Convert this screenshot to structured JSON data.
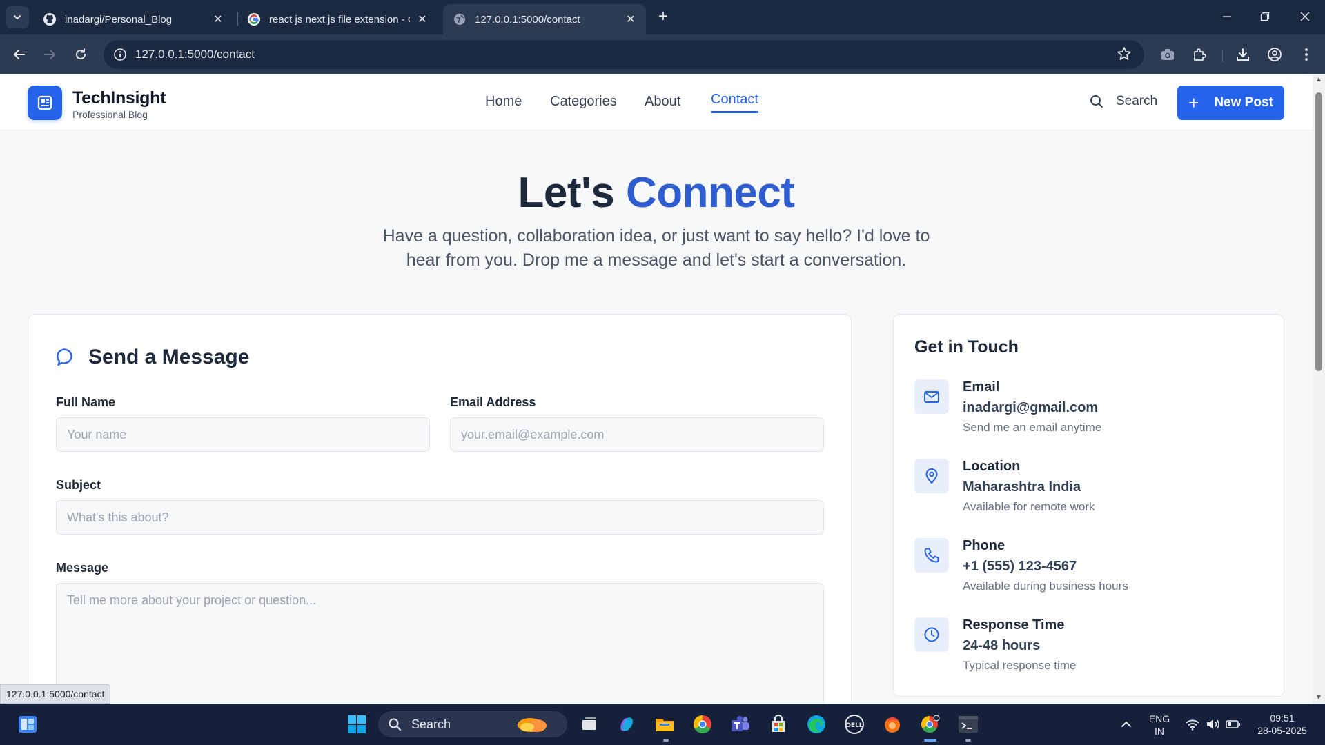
{
  "browser": {
    "tabs": [
      {
        "title": "inadargi/Personal_Blog",
        "favicon": "github-icon",
        "active": false
      },
      {
        "title": "react js next js file extension - G",
        "favicon": "google-icon",
        "active": false
      },
      {
        "title": "127.0.0.1:5000/contact",
        "favicon": "globe-icon",
        "active": true
      }
    ],
    "url": "127.0.0.1:5000/contact",
    "status_url": "127.0.0.1:5000/contact"
  },
  "site": {
    "brand_name": "TechInsight",
    "brand_tagline": "Professional Blog",
    "nav": [
      "Home",
      "Categories",
      "About",
      "Contact"
    ],
    "active_nav": "Contact",
    "search_label": "Search",
    "new_post_label": "New Post",
    "accent_color": "#2563eb"
  },
  "hero": {
    "title_prefix": "Let's",
    "title_accent": "Connect",
    "subtitle": "Have a question, collaboration idea, or just want to say hello? I'd love to hear from you. Drop me a message and let's start a conversation."
  },
  "form": {
    "title": "Send a Message",
    "full_name": {
      "label": "Full Name",
      "placeholder": "Your name"
    },
    "email": {
      "label": "Email Address",
      "placeholder": "your.email@example.com"
    },
    "subject": {
      "label": "Subject",
      "placeholder": "What's this about?"
    },
    "message": {
      "label": "Message",
      "placeholder": "Tell me more about your project or question..."
    }
  },
  "contact": {
    "title": "Get in Touch",
    "items": [
      {
        "icon": "mail-icon",
        "label": "Email",
        "value": "inadargi@gmail.com",
        "note": "Send me an email anytime"
      },
      {
        "icon": "location-pin-icon",
        "label": "Location",
        "value": "Maharashtra India",
        "note": "Available for remote work"
      },
      {
        "icon": "phone-icon",
        "label": "Phone",
        "value": "+1 (555) 123-4567",
        "note": "Available during business hours"
      },
      {
        "icon": "clock-icon",
        "label": "Response Time",
        "value": "24-48 hours",
        "note": "Typical response time"
      }
    ]
  },
  "taskbar": {
    "search_label": "Search",
    "language": "ENG",
    "region": "IN",
    "time": "09:51",
    "date": "28-05-2025"
  }
}
